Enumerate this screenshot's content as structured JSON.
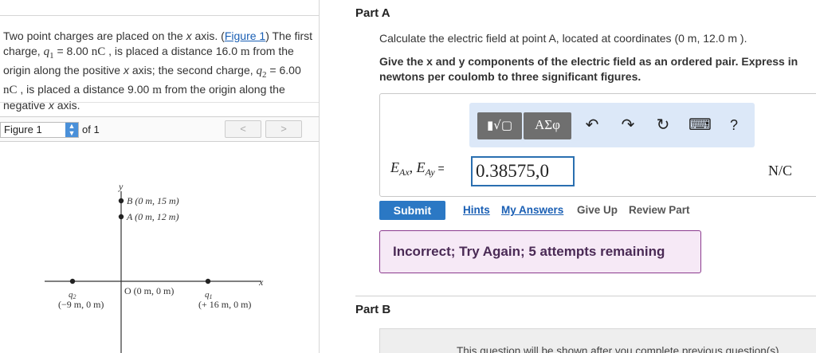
{
  "problem": {
    "t1": "Two point charges are placed on the ",
    "x1": "x",
    "t2": " axis. (",
    "figure_link": "Figure 1",
    "t3": ") The first charge, ",
    "q1": "q",
    "q1_sub": "1",
    "t4": " = 8.00 ",
    "nC1": "nC",
    "t5": " , is placed a distance 16.0 ",
    "m1": "m",
    "t6": " from the origin along the positive ",
    "x2": "x",
    "t7": " axis; the second charge, ",
    "q2": "q",
    "q2_sub": "2",
    "t8": " = 6.00 ",
    "nC2": "nC",
    "t9": " , is placed a distance 9.00 ",
    "m2": "m",
    "t10": " from the origin along the negative ",
    "x3": "x",
    "t11": " axis."
  },
  "figure_bar": {
    "selected": "Figure 1",
    "of": "of 1",
    "prev": "<",
    "next": ">"
  },
  "figure": {
    "y_axis": "y",
    "x_axis": "x",
    "point_b": "B (0 m, 15 m)",
    "point_a": "A (0 m, 12 m)",
    "origin": "O (0 m, 0 m)",
    "q2_label": "q",
    "q2_sub": "2",
    "q2_coord": "(−9 m, 0 m)",
    "q1_label": "q",
    "q1_sub": "1",
    "q1_coord": "(+ 16 m, 0 m)"
  },
  "part_a": {
    "title": "Part A",
    "question": "Calculate the electric field at point A, located at coordinates (0 m, 12.0 m ).",
    "instruction": "Give the x and y components of the electric field as an ordered pair. Express in newtons per coulomb to three significant figures."
  },
  "toolbar": {
    "templates": "▮√▢",
    "greek": "ΑΣφ",
    "undo": "↶",
    "redo": "↷",
    "reset": "↻",
    "keyboard": "⌨",
    "help": "?"
  },
  "answer": {
    "label_e1": "E",
    "label_sub1": "Ax",
    "label_sep": ", ",
    "label_e2": "E",
    "label_sub2": "Ay",
    "label_eq": " =",
    "value": "0.38575,0",
    "unit": "N/C"
  },
  "actions": {
    "submit": "Submit",
    "hints": "Hints",
    "my_answers": "My Answers",
    "give_up": "Give Up",
    "review": "Review Part"
  },
  "feedback": {
    "text": "Incorrect; Try Again; 5 attempts remaining"
  },
  "part_b": {
    "title": "Part B",
    "locked_text": "This question will be shown after you complete previous question(s)."
  },
  "colors": {
    "accent": "#2b78c4",
    "feedback_border": "#8b3a8e",
    "feedback_bg": "#f6e9f6",
    "toolbar_bg": "#dce8f8"
  }
}
